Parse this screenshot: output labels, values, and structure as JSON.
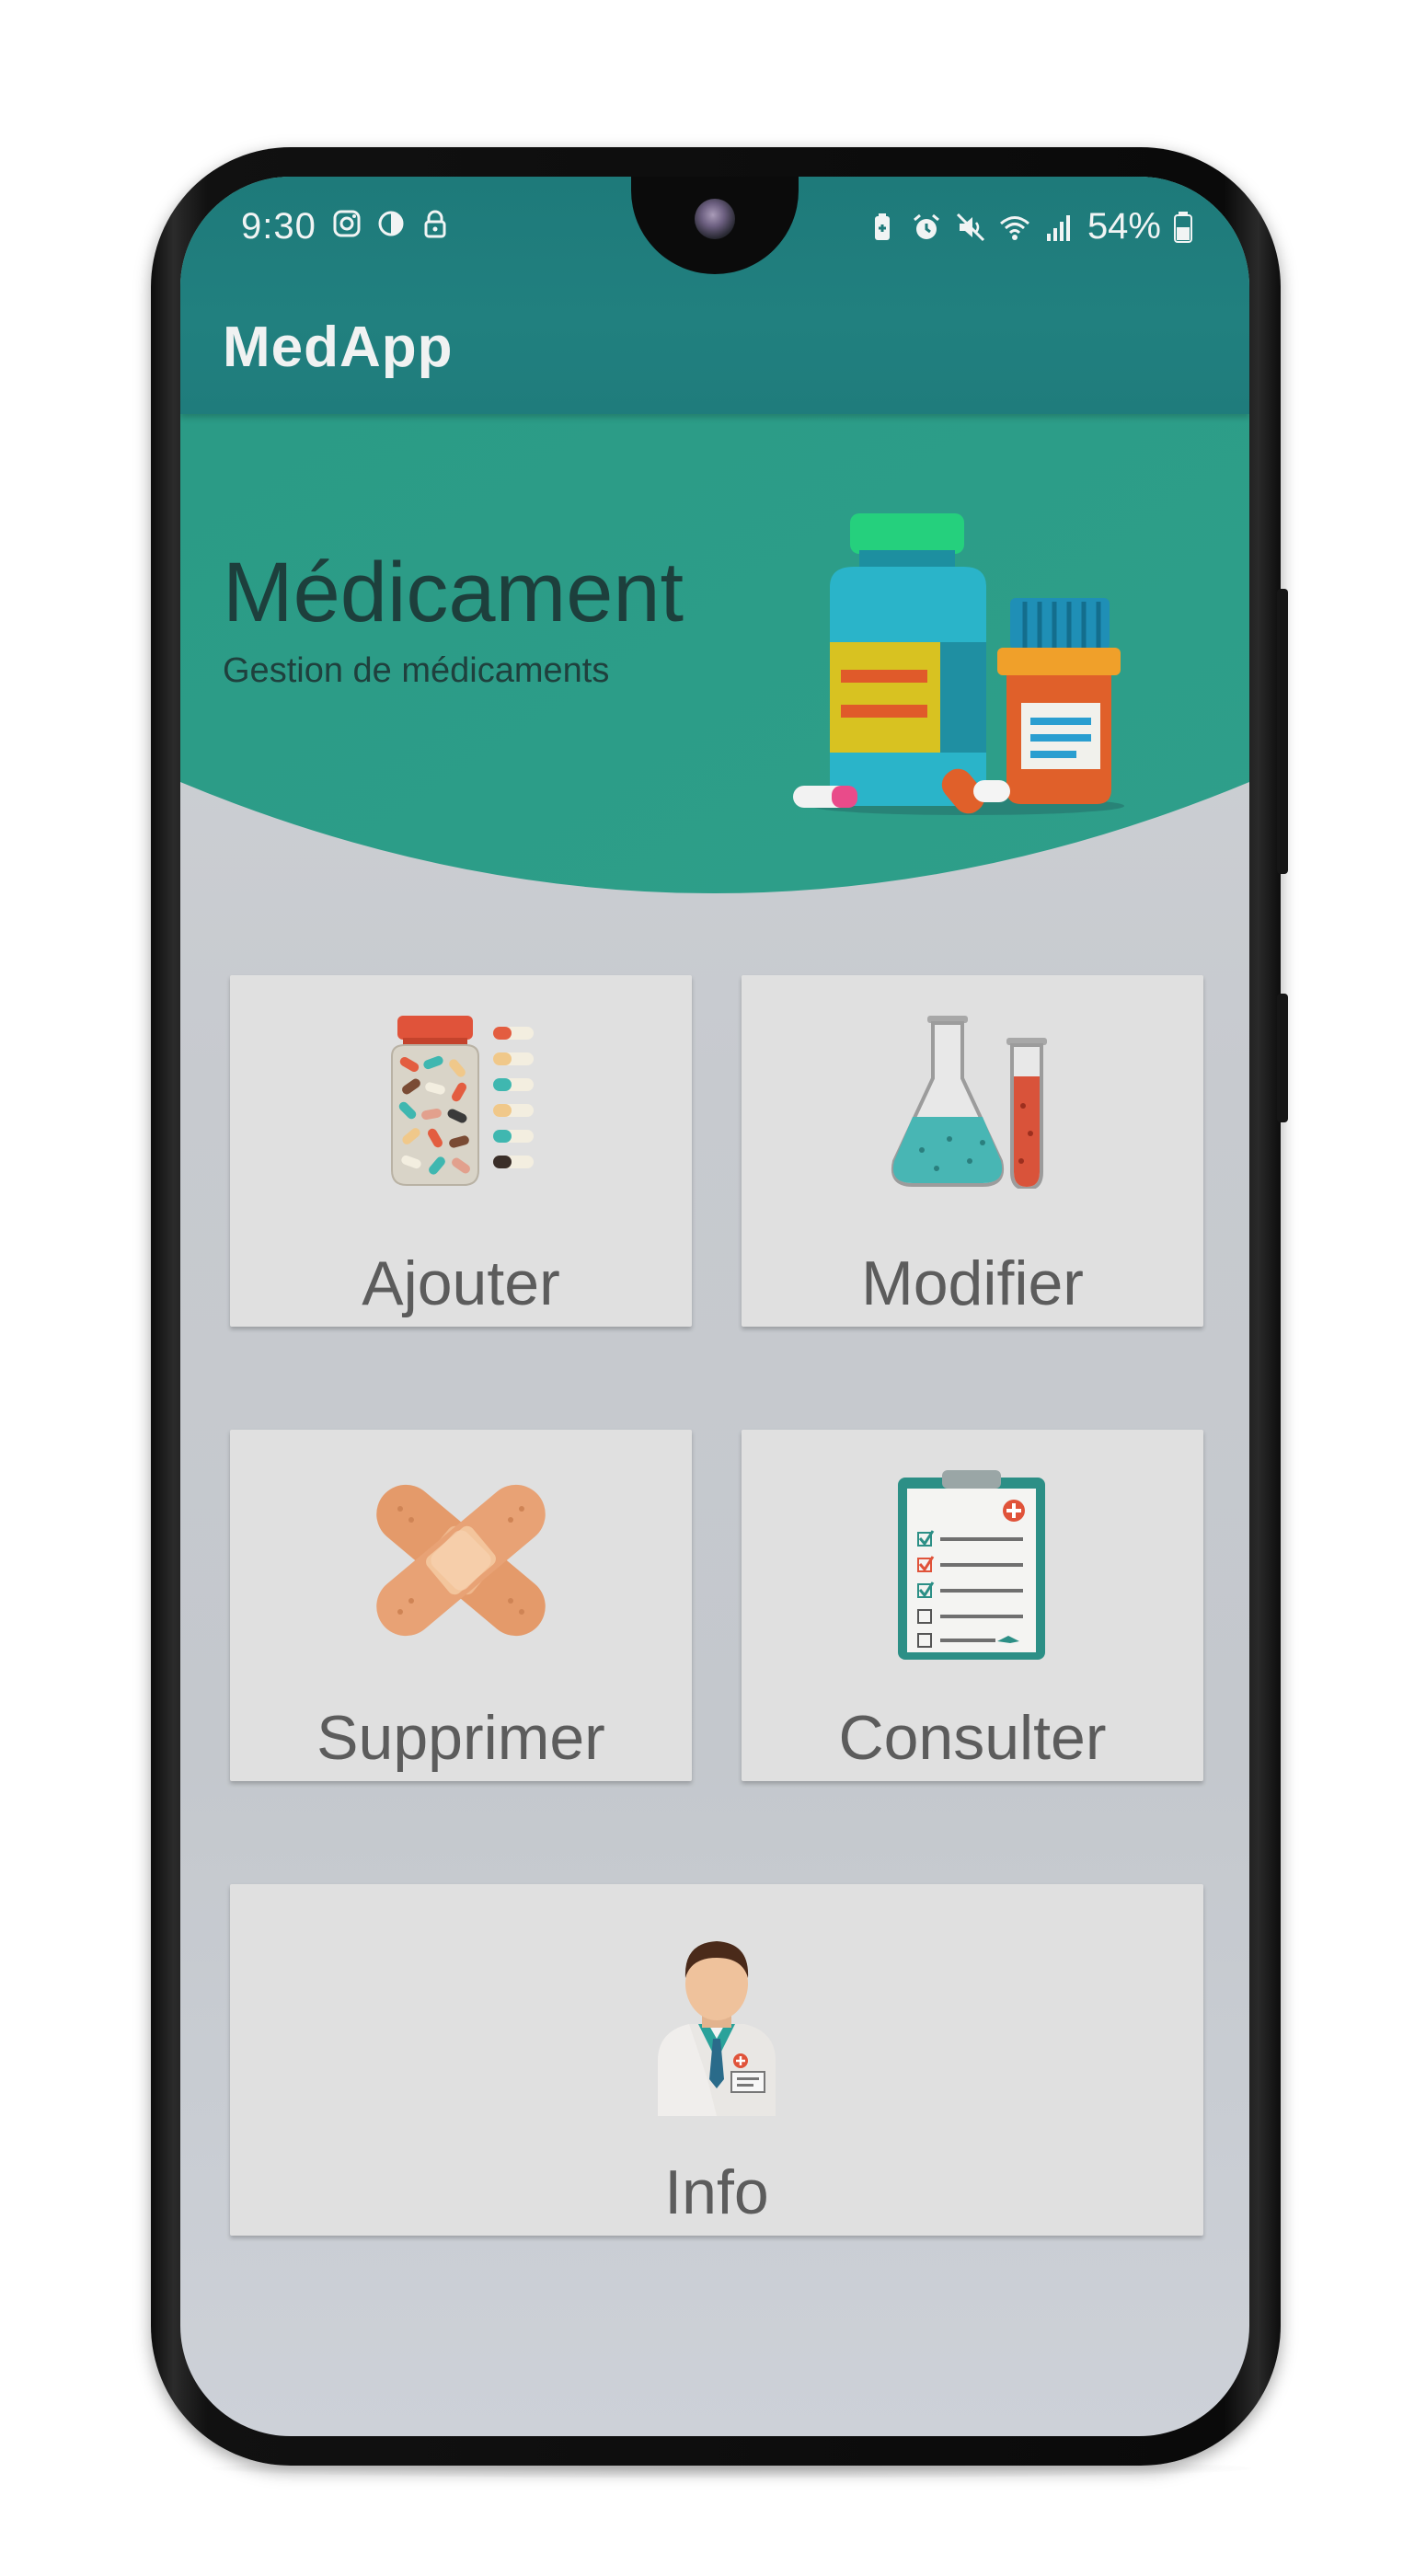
{
  "status_bar": {
    "time": "9:30",
    "battery": "54%",
    "left_icons": [
      "instagram-icon",
      "contrast-icon",
      "lock-icon"
    ],
    "right_icons": [
      "battery-saver-icon",
      "alarm-icon",
      "mute-icon",
      "wifi-icon",
      "signal-icon",
      "battery-icon"
    ]
  },
  "app_bar": {
    "title": "MedApp"
  },
  "hero": {
    "title": "Médicament",
    "subtitle": "Gestion de médicaments",
    "illustration": "medicine-bottles-icon"
  },
  "menu": {
    "add": {
      "label": "Ajouter",
      "icon": "pill-jar-icon"
    },
    "edit": {
      "label": "Modifier",
      "icon": "lab-flask-icon"
    },
    "delete": {
      "label": "Supprimer",
      "icon": "bandage-icon"
    },
    "view": {
      "label": "Consulter",
      "icon": "clipboard-icon"
    },
    "info": {
      "label": "Info",
      "icon": "doctor-icon"
    }
  },
  "colors": {
    "app_bar": "#1e7a7a",
    "hero": "#2a9a85",
    "card": "#e0e0e0",
    "card_text": "#5c5c5c",
    "hero_title": "#1d3f3c"
  }
}
